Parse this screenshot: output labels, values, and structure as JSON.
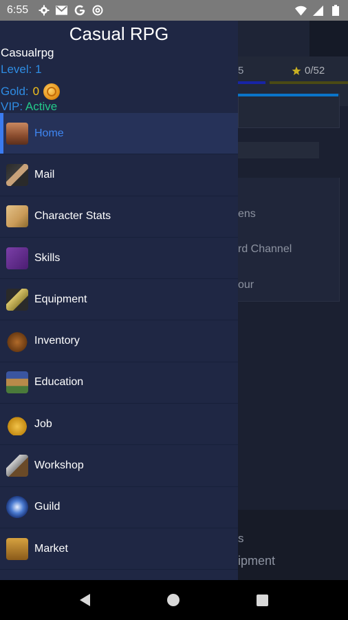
{
  "status_bar": {
    "time": "6:55",
    "left_icons": [
      "gear-icon",
      "gmail-icon",
      "google-icon",
      "at-sign-icon"
    ],
    "right_icons": [
      "wifi-icon",
      "cell-signal-icon",
      "battery-icon"
    ]
  },
  "drawer": {
    "app_title": "Casual RPG",
    "username": "Casualrpg",
    "level_label": "Level:",
    "level_value": "1",
    "gold_label": "Gold:",
    "gold_value": "0",
    "vip_label": "VIP:",
    "vip_value": "Active",
    "menu": [
      {
        "label": "Home",
        "icon": "home-icon",
        "active": true
      },
      {
        "label": "Mail",
        "icon": "mail-icon",
        "active": false
      },
      {
        "label": "Character Stats",
        "icon": "scroll-icon",
        "active": false
      },
      {
        "label": "Skills",
        "icon": "spellbook-icon",
        "active": false
      },
      {
        "label": "Equipment",
        "icon": "sword-icon",
        "active": false
      },
      {
        "label": "Inventory",
        "icon": "bag-icon",
        "active": false
      },
      {
        "label": "Education",
        "icon": "books-icon",
        "active": false
      },
      {
        "label": "Job",
        "icon": "coins-icon",
        "active": false
      },
      {
        "label": "Workshop",
        "icon": "hammer-icon",
        "active": false
      },
      {
        "label": "Guild",
        "icon": "shield-icon",
        "active": false
      },
      {
        "label": "Market",
        "icon": "scales-icon",
        "active": false
      }
    ]
  },
  "background": {
    "stat_left": "5",
    "stat_right": "0/52",
    "list_items": [
      "ens",
      "rd Channel",
      "our"
    ],
    "bottom_a": "s",
    "bottom_b": "ipment"
  },
  "colors": {
    "drawer_bg": "#1f2744",
    "active_item_bg": "#263259",
    "accent_blue": "#3b7bf0",
    "gold": "#f4c21c",
    "vip_green": "#24c98a"
  }
}
